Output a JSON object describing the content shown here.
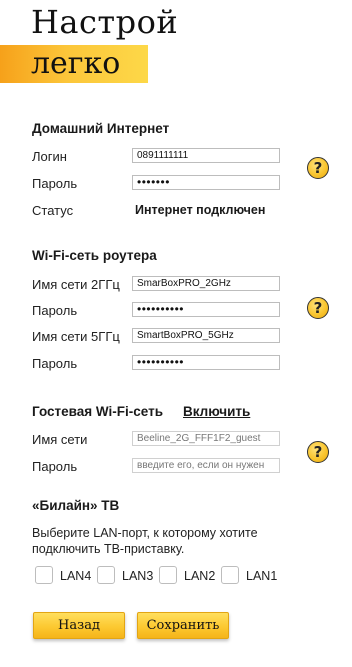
{
  "brand": {
    "title": "Настрой",
    "subtitle": "легко"
  },
  "home_internet": {
    "title": "Домашний Интернет",
    "login_label": "Логин",
    "login_value": "0891111111",
    "password_label": "Пароль",
    "password_value": "•••••••",
    "status_label": "Статус",
    "status_value": "Интернет подключен"
  },
  "wifi": {
    "title": "Wi-Fi-сеть роутера",
    "ssid_24_label": "Имя сети 2ГГц",
    "ssid_24_value": "SmarBoxPRO_2GHz",
    "password_24_label": "Пароль",
    "password_24_value": "••••••••••",
    "ssid_5_label": "Имя сети 5ГГц",
    "ssid_5_value": "SmartBoxPRO_5GHz",
    "password_5_label": "Пароль",
    "password_5_value": "••••••••••"
  },
  "guest": {
    "title": "Гостевая Wi-Fi-сеть",
    "enable_link": "Включить",
    "ssid_label": "Имя сети",
    "ssid_value": "Beeline_2G_FFF1F2_guest",
    "password_label": "Пароль",
    "password_placeholder": "введите его, если он нужен"
  },
  "tv": {
    "title": "«Билайн» ТВ",
    "description": "Выберите LAN-порт, к которому хотите подключить ТВ-приставку.",
    "ports": [
      "LAN4",
      "LAN3",
      "LAN2",
      "LAN1"
    ]
  },
  "help_icon": "?",
  "buttons": {
    "back": "Назад",
    "save": "Сохранить"
  },
  "colors": {
    "accent": "#fcc631",
    "accent_dark": "#f5a21a"
  }
}
